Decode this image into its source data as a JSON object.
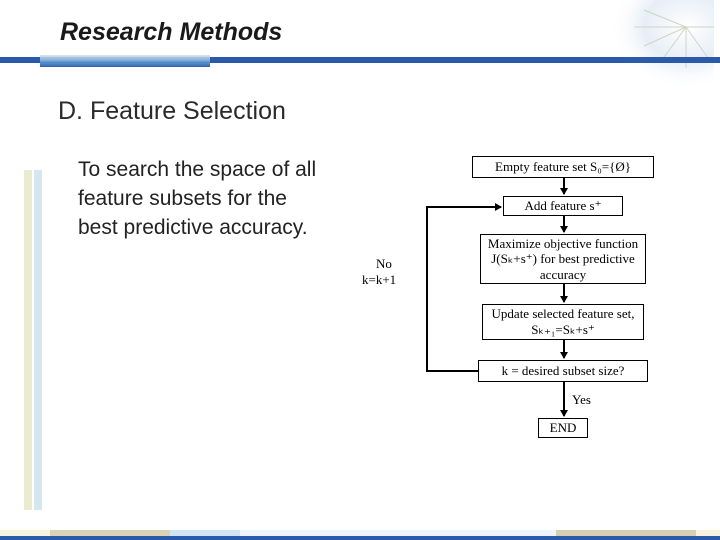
{
  "header": {
    "title": "Research Methods"
  },
  "section": {
    "heading": "D. Feature Selection"
  },
  "body": {
    "desc": "To search the space of all feature subsets for the best predictive accuracy."
  },
  "flow": {
    "b1": "Empty feature set S₀={Ø}",
    "b2": "Add feature s⁺",
    "b3": "Maximize objective function J(Sₖ+s⁺) for best predictive accuracy",
    "b4": "Update selected feature set, Sₖ₊₁=Sₖ+s⁺",
    "b5": "k = desired subset size?",
    "b6": "END",
    "loop_no_1": "No",
    "loop_no_2": "k=k+1",
    "yes": "Yes"
  }
}
